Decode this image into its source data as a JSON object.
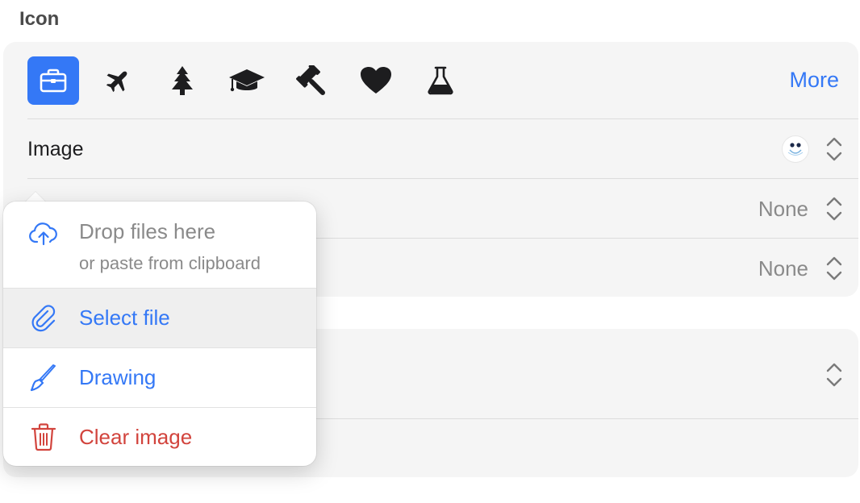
{
  "section": {
    "title": "Icon"
  },
  "icon_picker": {
    "icons": [
      {
        "name": "briefcase-icon",
        "selected": true
      },
      {
        "name": "airplane-icon",
        "selected": false
      },
      {
        "name": "tree-icon",
        "selected": false
      },
      {
        "name": "graduation-cap-icon",
        "selected": false
      },
      {
        "name": "gavel-icon",
        "selected": false
      },
      {
        "name": "heart-icon",
        "selected": false
      },
      {
        "name": "flask-icon",
        "selected": false
      }
    ],
    "more_label": "More",
    "accent_color": "#3478f6"
  },
  "rows": {
    "image": {
      "label": "Image"
    },
    "row2": {
      "value": "None"
    },
    "row3": {
      "value": "None"
    }
  },
  "popover": {
    "drop_title": "Drop files here",
    "drop_subtitle": "or paste from clipboard",
    "select_file": "Select file",
    "drawing": "Drawing",
    "clear_image": "Clear image",
    "destructive_color": "#d2443d"
  }
}
